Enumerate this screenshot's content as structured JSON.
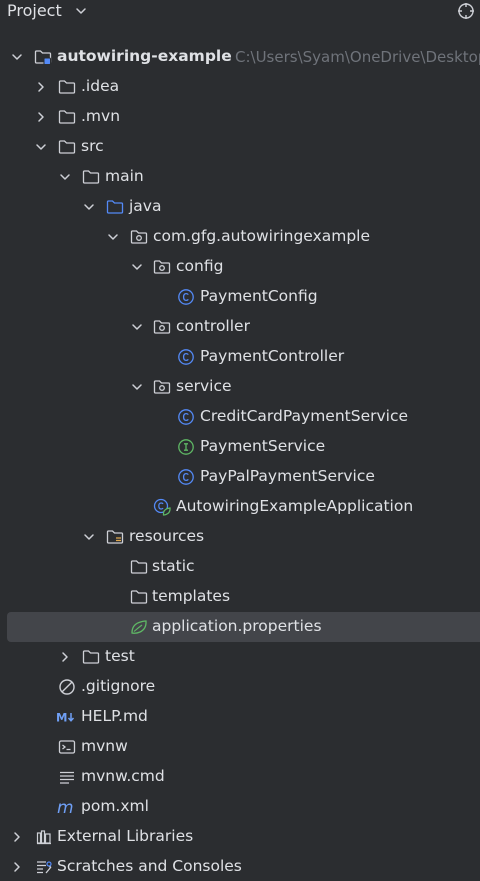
{
  "header": {
    "title": "Project"
  },
  "tree": {
    "root": {
      "label": "autowiring-example",
      "path": "C:\\Users\\Syam\\OneDrive\\Desktop"
    },
    "idea": ".idea",
    "mvn": ".mvn",
    "src": "src",
    "main": "main",
    "java": "java",
    "package": "com.gfg.autowiringexample",
    "config": "config",
    "payment_config": "PaymentConfig",
    "controller": "controller",
    "payment_controller": "PaymentController",
    "service": "service",
    "credit_card_service": "CreditCardPaymentService",
    "payment_service": "PaymentService",
    "paypal_service": "PayPalPaymentService",
    "application_class": "AutowiringExampleApplication",
    "resources": "resources",
    "static": "static",
    "templates": "templates",
    "application_properties": "application.properties",
    "test": "test",
    "gitignore": ".gitignore",
    "help_md": "HELP.md",
    "mvnw": "mvnw",
    "mvnw_cmd": "mvnw.cmd",
    "pom_xml": "pom.xml",
    "external_libraries": "External Libraries",
    "scratches": "Scratches and Consoles"
  },
  "colors": {
    "background": "#2b2d30",
    "text": "#dfe1e5",
    "muted_path": "#6f737a",
    "selection": "#43454a",
    "class_icon": "#548af7",
    "interface_icon": "#5fb865",
    "folder_icon": "#ced0d6",
    "java_folder_icon": "#548af7",
    "spring_leaf": "#5fb865"
  },
  "icons": {
    "locate": "locate-icon",
    "folder": "folder-icon",
    "module": "module-icon",
    "package": "package-icon",
    "class": "class-icon",
    "interface": "interface-icon",
    "spring_boot_class": "spring-boot-class-icon",
    "properties": "spring-properties-icon",
    "gitignore": "ignore-file-icon",
    "markdown": "markdown-icon",
    "shell": "shell-script-icon",
    "text": "text-file-icon",
    "maven": "maven-icon",
    "libraries": "libraries-icon",
    "scratches": "scratches-icon"
  }
}
